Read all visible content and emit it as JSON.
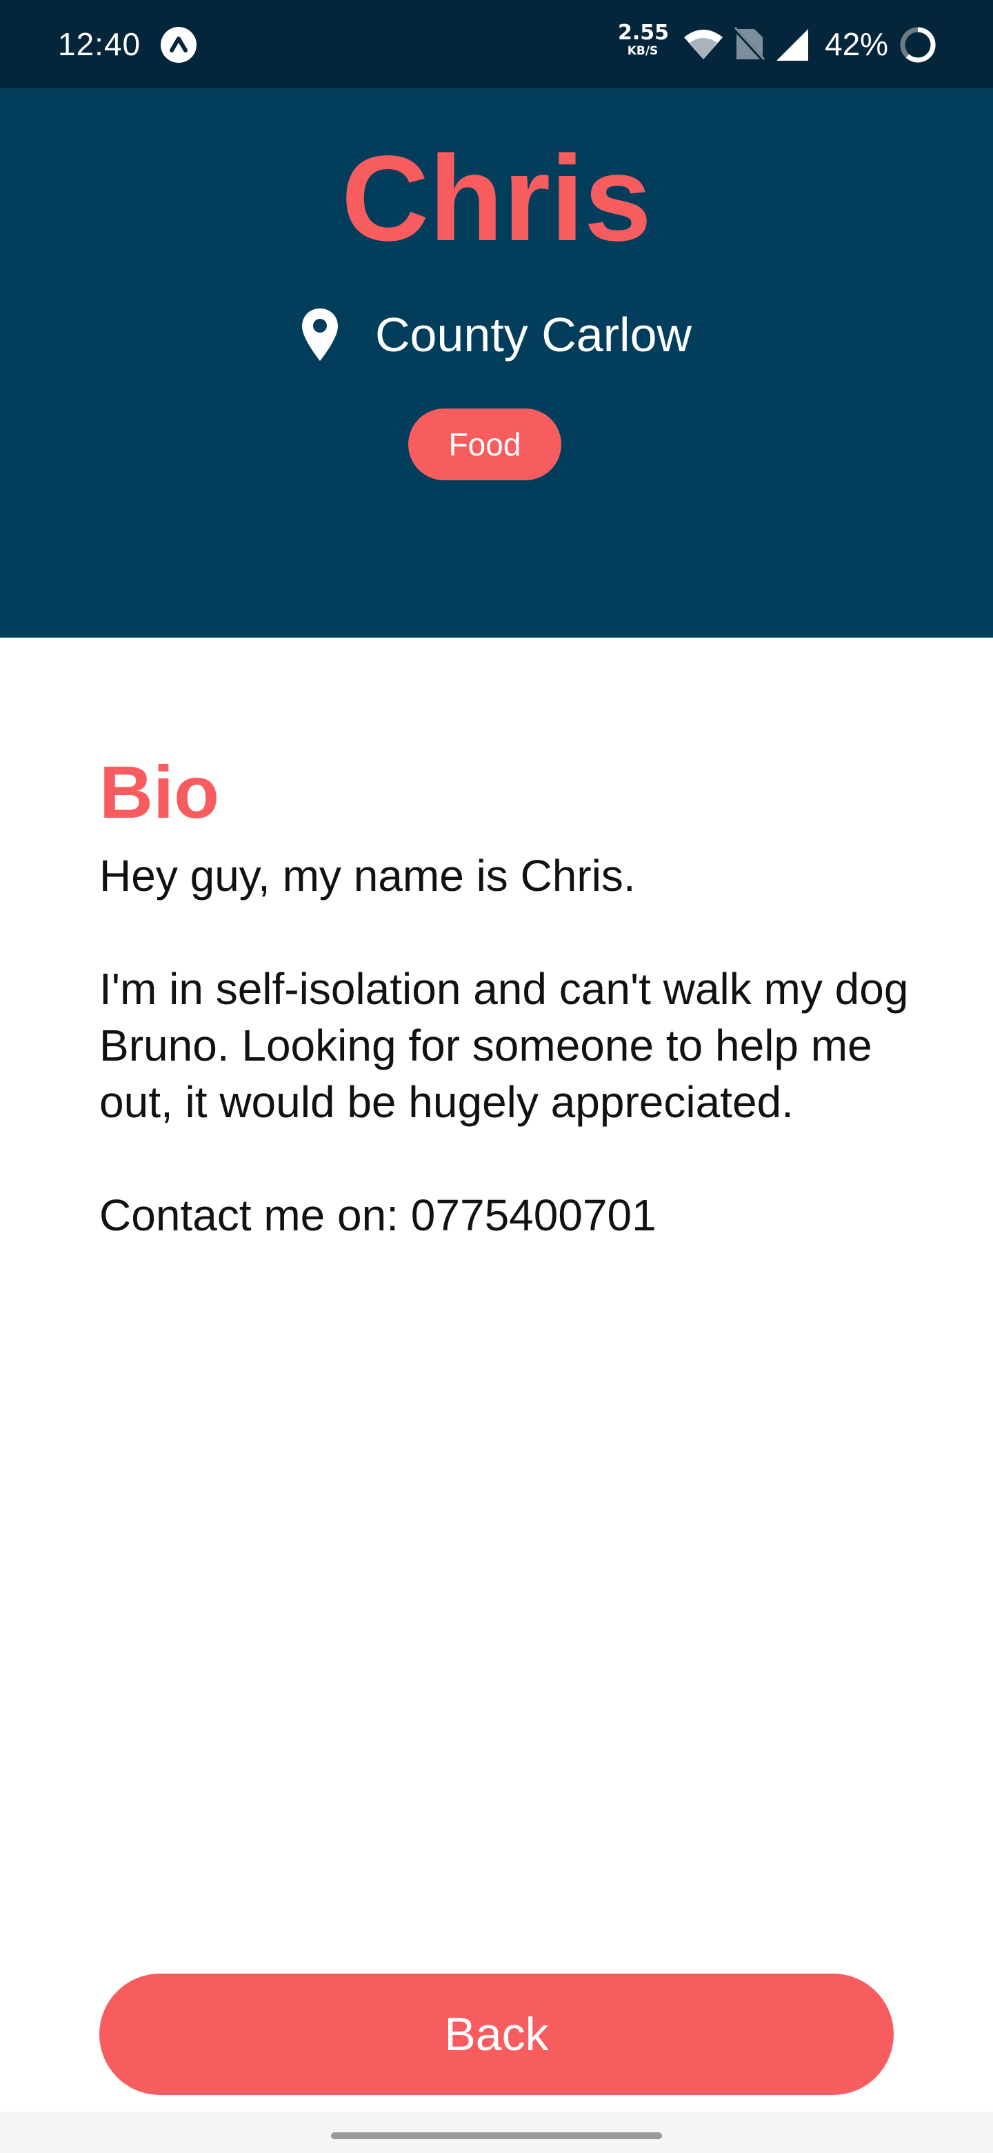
{
  "status_bar": {
    "time": "12:40",
    "app_icon": "arrow-up-circle-icon",
    "speed_value": "2.55",
    "speed_unit": "KB/S",
    "battery": "42%",
    "icons": [
      "wifi-icon",
      "no-sim-icon",
      "signal-icon",
      "battery-ring-icon"
    ]
  },
  "profile": {
    "name": "Chris",
    "location_icon": "map-pin-icon",
    "location": "County Carlow",
    "tag": "Food"
  },
  "bio": {
    "title": "Bio",
    "paragraphs": [
      "Hey guy, my name is Chris.",
      "I'm in self-isolation and can't walk my dog Bruno. Looking for someone to help me out, it would be hugely appreciated.",
      "Contact me on: 0775400701"
    ]
  },
  "actions": {
    "back_label": "Back"
  },
  "colors": {
    "status_bar": "#05263a",
    "header_bg": "#023e5c",
    "accent": "#f75d5f",
    "text": "#111111"
  }
}
